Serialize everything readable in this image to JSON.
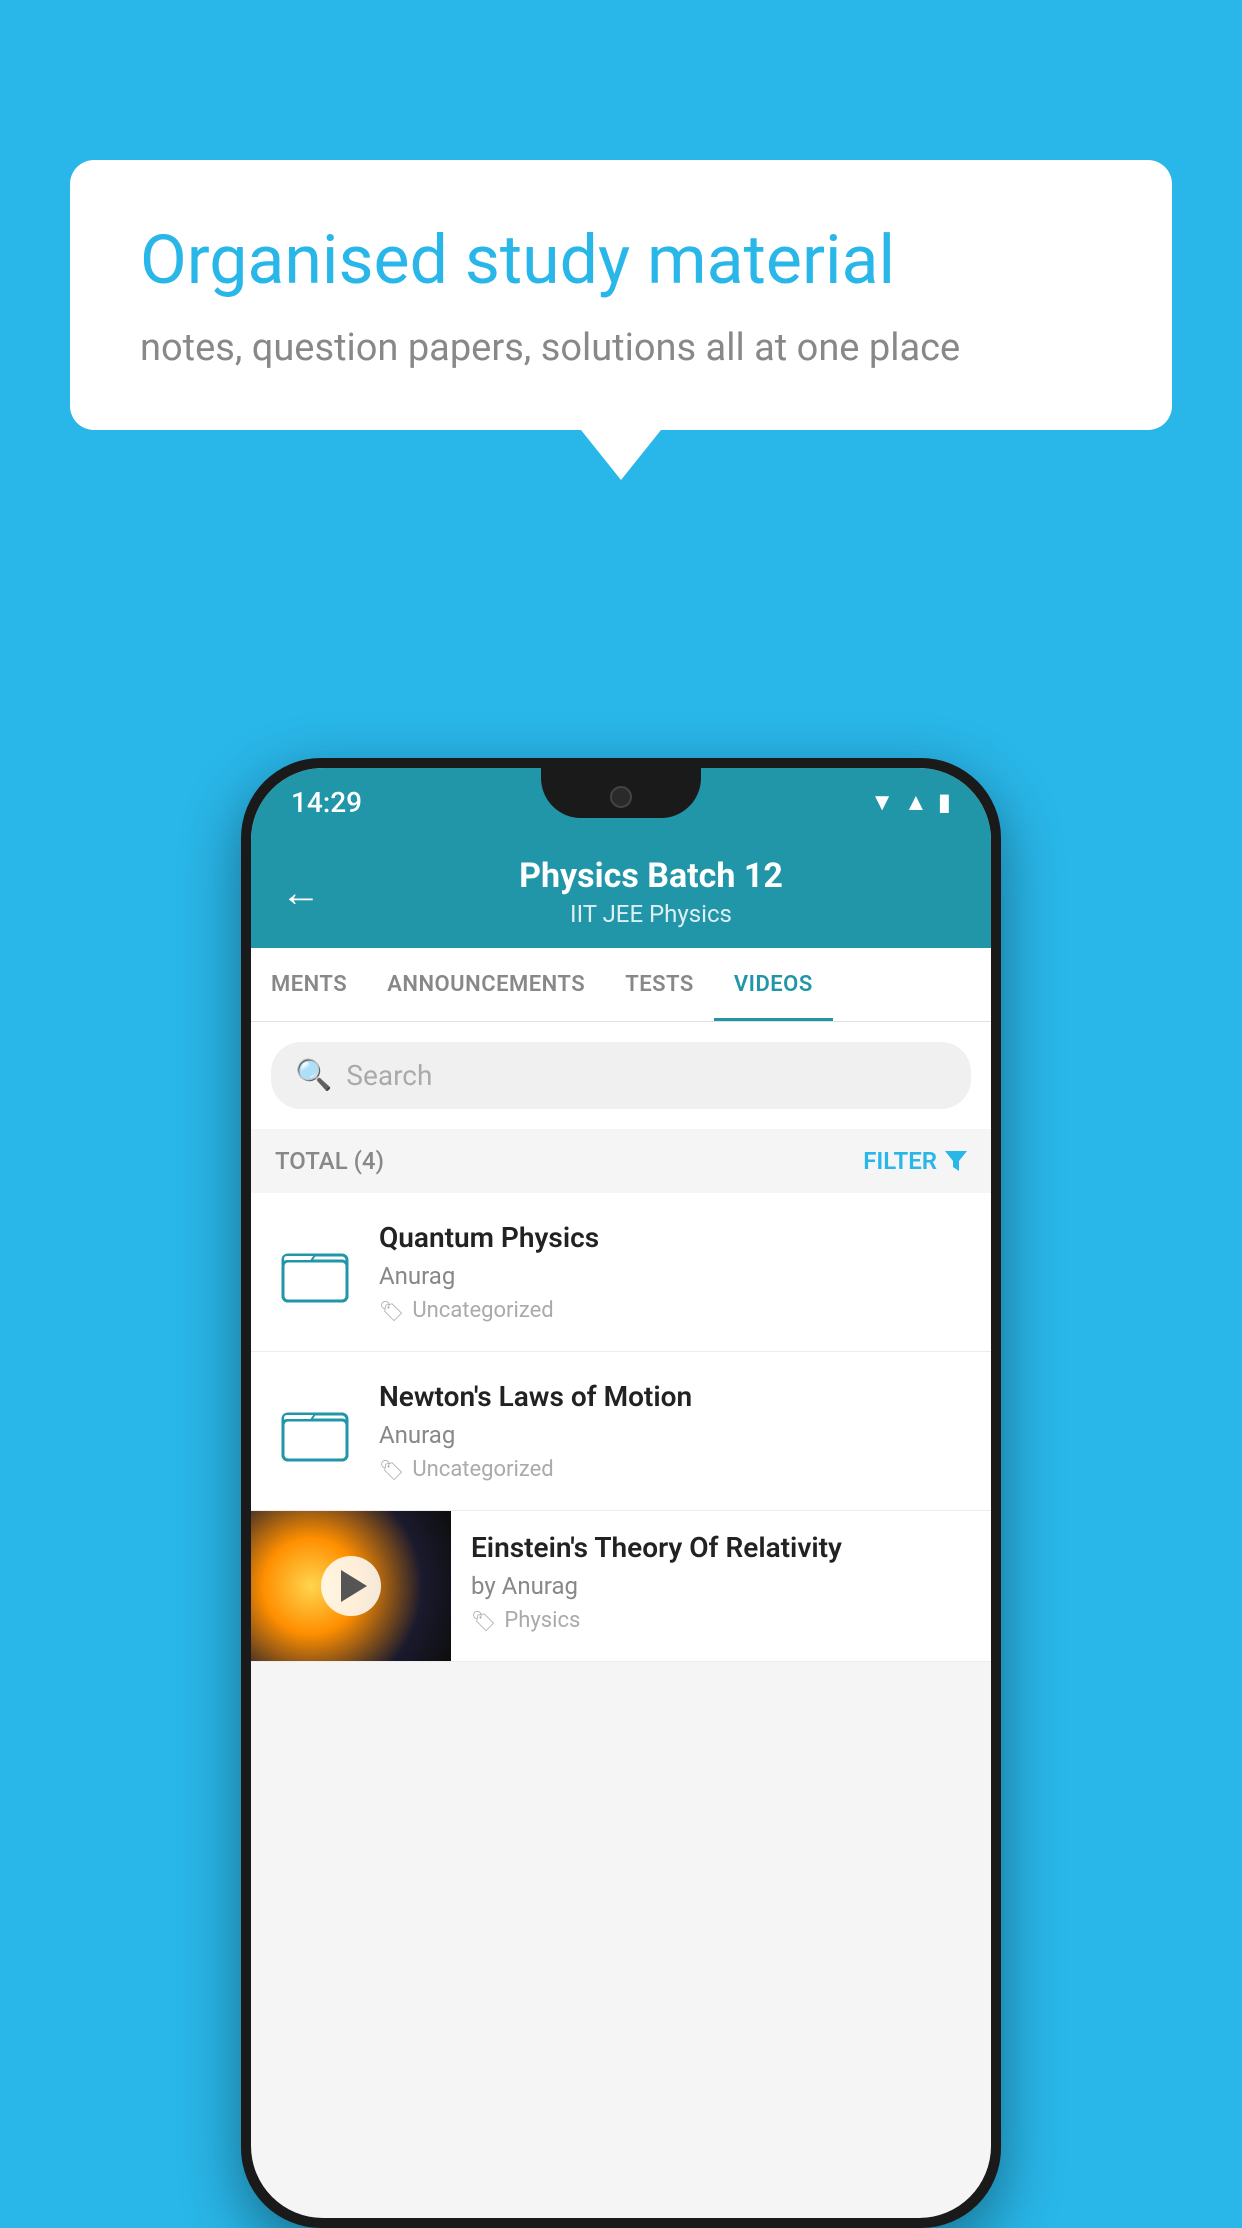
{
  "background_color": "#29B6E8",
  "speech_bubble": {
    "title": "Organised study material",
    "subtitle": "notes, question papers, solutions all at one place"
  },
  "phone": {
    "status_bar": {
      "time": "14:29",
      "wifi": "▼",
      "signal": "▲",
      "battery": "▮"
    },
    "header": {
      "back_label": "←",
      "title": "Physics Batch 12",
      "subtitle": "IIT JEE   Physics"
    },
    "tabs": [
      {
        "label": "MENTS",
        "active": false
      },
      {
        "label": "ANNOUNCEMENTS",
        "active": false
      },
      {
        "label": "TESTS",
        "active": false
      },
      {
        "label": "VIDEOS",
        "active": true
      }
    ],
    "search": {
      "placeholder": "Search"
    },
    "filter_row": {
      "total": "TOTAL (4)",
      "filter_label": "FILTER"
    },
    "items": [
      {
        "type": "folder",
        "title": "Quantum Physics",
        "author": "Anurag",
        "tag": "Uncategorized"
      },
      {
        "type": "folder",
        "title": "Newton's Laws of Motion",
        "author": "Anurag",
        "tag": "Uncategorized"
      },
      {
        "type": "video",
        "title": "Einstein's Theory Of Relativity",
        "author": "by Anurag",
        "tag": "Physics"
      }
    ]
  }
}
